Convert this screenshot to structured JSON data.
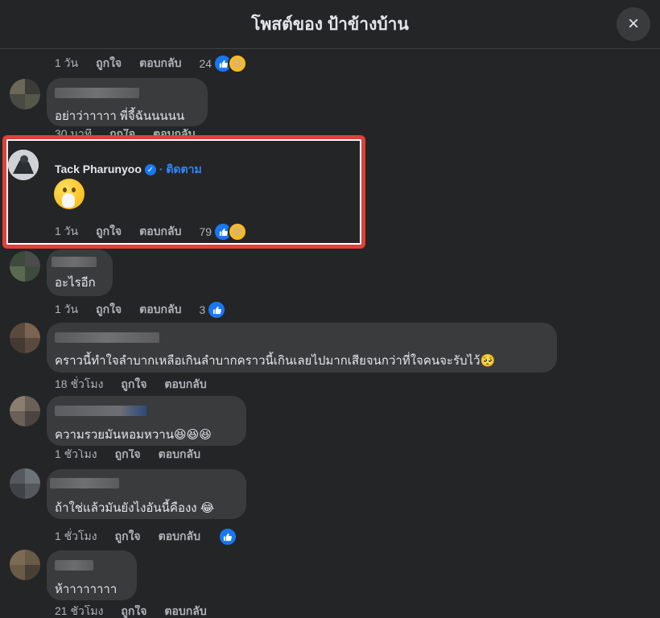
{
  "header": {
    "title": "โพสต์ของ ป้าข้างบ้าน",
    "close_icon": "×"
  },
  "actions": {
    "like": "ถูกใจ",
    "reply": "ตอบกลับ"
  },
  "comments": [
    {
      "text": "",
      "time": "1 วัน",
      "count": "24"
    },
    {
      "text": "อย่าว่าาาาา พี่จี้ฉันนนนน",
      "time": "30 นาที"
    },
    {
      "name": "Tack Pharunyoo",
      "follow": "· ติดตาม",
      "time": "1 วัน",
      "count": "79"
    },
    {
      "text": "อะไรอีก",
      "time": "1 วัน",
      "count": "3"
    },
    {
      "text": "คราวนี้ทำใจลำบากเหลือเกินลำบากคราวนี้เกินเลยไปมากเสียจนกว่าที่ใจคนจะรับไว้🥺",
      "time": "18 ชั่วโมง"
    },
    {
      "text": "ความรวยมันหอมหวาน😆😆😆",
      "time": "1 ชั่วโมง"
    },
    {
      "text": "ถ้าใช่แล้วมันยังไงอันนี้คืองง 😂",
      "time": "1 ชั่วโมง"
    },
    {
      "text": "ห้าาาาาาาา",
      "time": "21 ชั่วโมง"
    }
  ],
  "colors": {
    "background": "#242526",
    "bubble": "#3a3b3c",
    "accent": "#1877f2",
    "highlight": "#e0403a"
  }
}
